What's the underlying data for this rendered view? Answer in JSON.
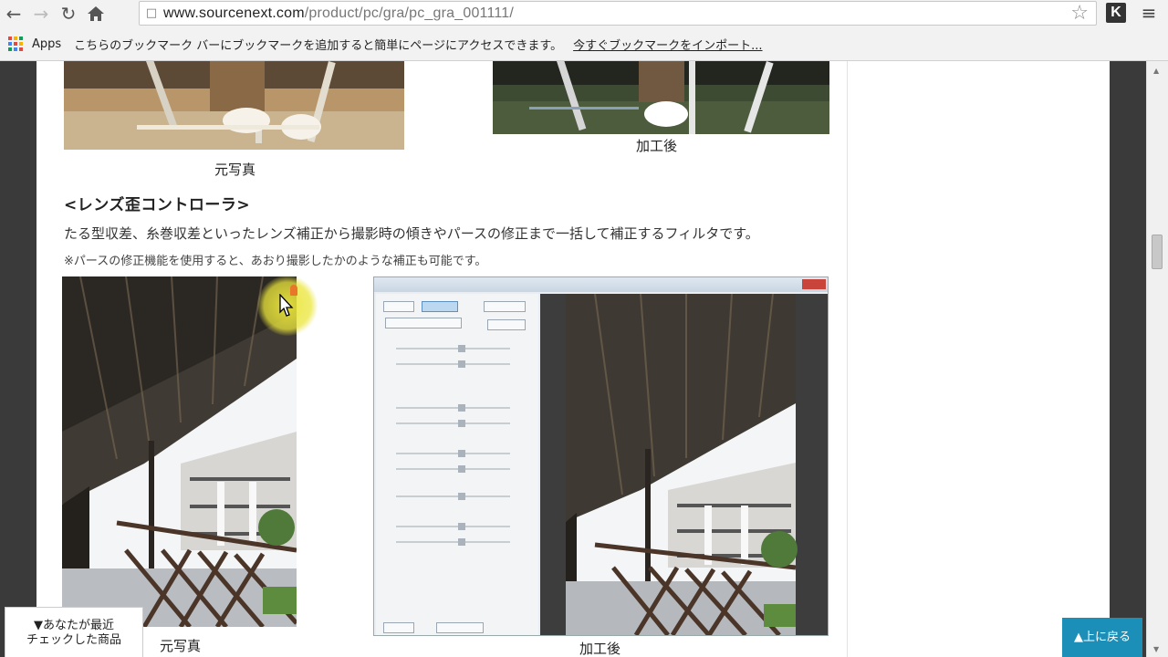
{
  "browser": {
    "url_host": "www.sourcenext.com",
    "url_path": "/product/pc/gra/pc_gra_001111/",
    "bookmarks_apps": "Apps",
    "bookmarks_message": "こちらのブックマーク バーにブックマークを追加すると簡単にページにアクセスできます。",
    "bookmarks_import_link": "今すぐブックマークをインポート...",
    "extension_label": "K"
  },
  "content": {
    "top_left_caption": "元写真",
    "top_right_caption": "加工後",
    "section_heading": "<レンズ歪コントローラ>",
    "section_description": "たる型収差、糸巻収差といったレンズ補正から撮影時の傾きやパースの修正まで一括して補正するフィルタです。",
    "section_note": "※パースの修正機能を使用すると、あおり撮影したかのような補正も可能です。",
    "bottom_left_caption": "元写真",
    "bottom_right_caption": "加工後"
  },
  "widgets": {
    "recent_line1": "▼あなたが最近",
    "recent_line2": "チェックした商品",
    "back_to_top": "▲上に戻る"
  }
}
